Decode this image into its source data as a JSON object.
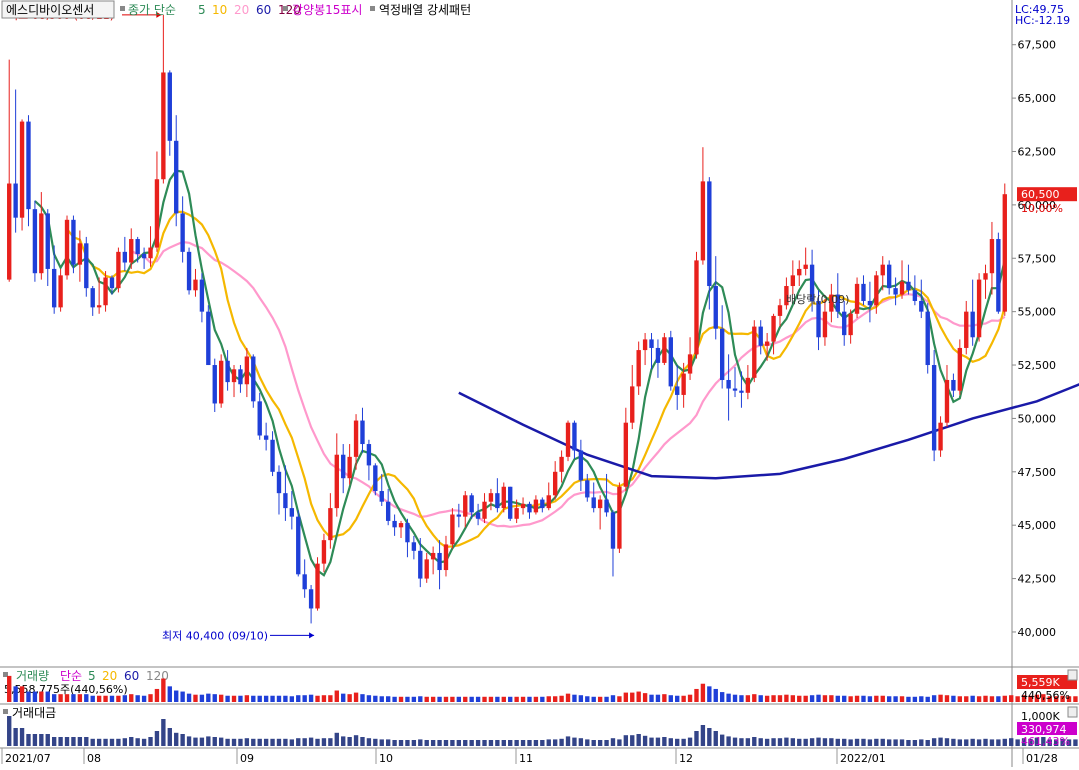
{
  "header": {
    "stock_name": "에스디바이오센서",
    "price_label": "종가",
    "ma_label": "단순",
    "ma_periods": [
      "5",
      "10",
      "20",
      "60",
      "120"
    ],
    "ma_colors": [
      "#2e8b57",
      "#f5b800",
      "#ff99cc",
      "#1a1aa8",
      "#800040"
    ],
    "highlight_label": "강양봉15표시",
    "pattern_label": "역정배열 강세패턴",
    "lc_label": "LC:49.75",
    "hc_label": "HC:-12.19"
  },
  "annotations": {
    "high": "최고 68,900 (08/11)",
    "low": "최저 40,400 (09/10)",
    "dividend": "배당락(0.09)"
  },
  "price_axis": {
    "ticks": [
      "67,500",
      "65,000",
      "62,500",
      "60,000",
      "57,500",
      "55,000",
      "52,500",
      "50,000",
      "47,500",
      "45,000",
      "42,500",
      "40,000"
    ],
    "current_price": "60,500",
    "current_pct": "10,00%"
  },
  "date_axis": [
    "2021/07",
    "08",
    "09",
    "10",
    "11",
    "12",
    "2022/01",
    "01/28"
  ],
  "volume_panel": {
    "title": "거래량",
    "ma_label": "단순",
    "ma_periods": [
      "5",
      "20",
      "60",
      "120"
    ],
    "value_text": "5,558,775주(440,56%)",
    "badge": "5,559K",
    "badge_pct": "440,56%"
  },
  "amount_panel": {
    "title": "거래대금",
    "axis_label": "1,000K",
    "badge": "330,974",
    "badge_pct": "461,43%"
  },
  "colors": {
    "up": "#e8201c",
    "down": "#1f3fd8",
    "highlight": "#c8f8fa",
    "badge": "#e8201c"
  },
  "chart_data": {
    "type": "candlestick",
    "y_unit": "KRW",
    "ylim": [
      38500,
      69500
    ],
    "candles": [
      {
        "o": 56500,
        "h": 66800,
        "l": 56400,
        "c": 61000
      },
      {
        "o": 61000,
        "h": 65400,
        "l": 58700,
        "c": 59400
      },
      {
        "o": 59400,
        "h": 64000,
        "l": 58800,
        "c": 63900
      },
      {
        "o": 63900,
        "h": 64200,
        "l": 59000,
        "c": 59800
      },
      {
        "o": 59800,
        "h": 60200,
        "l": 56400,
        "c": 56800
      },
      {
        "o": 56800,
        "h": 60600,
        "l": 56500,
        "c": 59600
      },
      {
        "o": 59600,
        "h": 59800,
        "l": 56200,
        "c": 57000
      },
      {
        "o": 57000,
        "h": 58100,
        "l": 54900,
        "c": 55200
      },
      {
        "o": 55200,
        "h": 57000,
        "l": 55000,
        "c": 56700
      },
      {
        "o": 56700,
        "h": 59500,
        "l": 56500,
        "c": 59300
      },
      {
        "o": 59300,
        "h": 59500,
        "l": 56800,
        "c": 57200
      },
      {
        "o": 57200,
        "h": 58800,
        "l": 56400,
        "c": 58200
      },
      {
        "o": 58200,
        "h": 58500,
        "l": 55700,
        "c": 56100
      },
      {
        "o": 56100,
        "h": 56200,
        "l": 54800,
        "c": 55200
      },
      {
        "o": 55200,
        "h": 56600,
        "l": 54900,
        "c": 55300
      },
      {
        "o": 55300,
        "h": 56900,
        "l": 55000,
        "c": 56600
      },
      {
        "o": 56600,
        "h": 56700,
        "l": 55800,
        "c": 56100
      },
      {
        "o": 56100,
        "h": 58000,
        "l": 55900,
        "c": 57800
      },
      {
        "o": 57800,
        "h": 58500,
        "l": 56900,
        "c": 57300
      },
      {
        "o": 57300,
        "h": 58900,
        "l": 57000,
        "c": 58400
      },
      {
        "o": 58400,
        "h": 58500,
        "l": 57300,
        "c": 57700
      },
      {
        "o": 57700,
        "h": 58000,
        "l": 57000,
        "c": 57500
      },
      {
        "o": 57500,
        "h": 59000,
        "l": 57100,
        "c": 58000
      },
      {
        "o": 58000,
        "h": 62500,
        "l": 57800,
        "c": 61200
      },
      {
        "o": 61200,
        "h": 68900,
        "l": 61000,
        "c": 66200
      },
      {
        "o": 66200,
        "h": 66300,
        "l": 62300,
        "c": 63000
      },
      {
        "o": 63000,
        "h": 64200,
        "l": 59000,
        "c": 59600
      },
      {
        "o": 59600,
        "h": 60400,
        "l": 57300,
        "c": 57800
      },
      {
        "o": 57800,
        "h": 58000,
        "l": 55800,
        "c": 56000
      },
      {
        "o": 56000,
        "h": 57000,
        "l": 55700,
        "c": 56500
      },
      {
        "o": 56500,
        "h": 56800,
        "l": 54500,
        "c": 55000
      },
      {
        "o": 55000,
        "h": 55300,
        "l": 52500,
        "c": 52500
      },
      {
        "o": 52500,
        "h": 52800,
        "l": 50300,
        "c": 50700
      },
      {
        "o": 50700,
        "h": 53000,
        "l": 50500,
        "c": 52700
      },
      {
        "o": 52700,
        "h": 53200,
        "l": 51300,
        "c": 51700
      },
      {
        "o": 51700,
        "h": 52500,
        "l": 51000,
        "c": 52300
      },
      {
        "o": 52300,
        "h": 52500,
        "l": 51200,
        "c": 51600
      },
      {
        "o": 51600,
        "h": 53300,
        "l": 51000,
        "c": 52900
      },
      {
        "o": 52900,
        "h": 53000,
        "l": 50500,
        "c": 50800
      },
      {
        "o": 50800,
        "h": 51200,
        "l": 49000,
        "c": 49200
      },
      {
        "o": 49200,
        "h": 49800,
        "l": 48500,
        "c": 49000
      },
      {
        "o": 49000,
        "h": 49400,
        "l": 47300,
        "c": 47500
      },
      {
        "o": 47500,
        "h": 47800,
        "l": 45500,
        "c": 46500
      },
      {
        "o": 46500,
        "h": 47800,
        "l": 45200,
        "c": 45800
      },
      {
        "o": 45800,
        "h": 46600,
        "l": 44800,
        "c": 45400
      },
      {
        "o": 45400,
        "h": 45700,
        "l": 42600,
        "c": 42700
      },
      {
        "o": 42700,
        "h": 43400,
        "l": 41600,
        "c": 42000
      },
      {
        "o": 42000,
        "h": 42200,
        "l": 40400,
        "c": 41100
      },
      {
        "o": 41100,
        "h": 43500,
        "l": 41000,
        "c": 43200
      },
      {
        "o": 43200,
        "h": 44600,
        "l": 42800,
        "c": 44300
      },
      {
        "o": 44300,
        "h": 46500,
        "l": 43900,
        "c": 45800
      },
      {
        "o": 45800,
        "h": 49300,
        "l": 45400,
        "c": 48300
      },
      {
        "o": 48300,
        "h": 48800,
        "l": 46500,
        "c": 47200
      },
      {
        "o": 47200,
        "h": 48800,
        "l": 46900,
        "c": 48200
      },
      {
        "o": 48200,
        "h": 50200,
        "l": 47600,
        "c": 49900
      },
      {
        "o": 49900,
        "h": 50500,
        "l": 48400,
        "c": 48800
      },
      {
        "o": 48800,
        "h": 49000,
        "l": 47100,
        "c": 47800
      },
      {
        "o": 47800,
        "h": 47900,
        "l": 46400,
        "c": 46600
      },
      {
        "o": 46600,
        "h": 47400,
        "l": 45900,
        "c": 46100
      },
      {
        "o": 46100,
        "h": 46700,
        "l": 45000,
        "c": 45200
      },
      {
        "o": 45200,
        "h": 45500,
        "l": 44500,
        "c": 44900
      },
      {
        "o": 44900,
        "h": 45200,
        "l": 44400,
        "c": 45100
      },
      {
        "o": 45100,
        "h": 45300,
        "l": 43500,
        "c": 44200
      },
      {
        "o": 44200,
        "h": 44500,
        "l": 43400,
        "c": 43800
      },
      {
        "o": 43800,
        "h": 44400,
        "l": 42100,
        "c": 42500
      },
      {
        "o": 42500,
        "h": 43700,
        "l": 42300,
        "c": 43400
      },
      {
        "o": 43400,
        "h": 44000,
        "l": 42700,
        "c": 43700
      },
      {
        "o": 43700,
        "h": 44300,
        "l": 42000,
        "c": 42900
      },
      {
        "o": 42900,
        "h": 44500,
        "l": 42600,
        "c": 44100
      },
      {
        "o": 44100,
        "h": 45800,
        "l": 43900,
        "c": 45500
      },
      {
        "o": 45500,
        "h": 46000,
        "l": 44900,
        "c": 45400
      },
      {
        "o": 45400,
        "h": 46600,
        "l": 44900,
        "c": 46400
      },
      {
        "o": 46400,
        "h": 46500,
        "l": 45300,
        "c": 45600
      },
      {
        "o": 45600,
        "h": 46000,
        "l": 45000,
        "c": 45300
      },
      {
        "o": 45300,
        "h": 46500,
        "l": 45100,
        "c": 46100
      },
      {
        "o": 46100,
        "h": 46700,
        "l": 45700,
        "c": 46500
      },
      {
        "o": 46500,
        "h": 47200,
        "l": 45600,
        "c": 45800
      },
      {
        "o": 45800,
        "h": 47000,
        "l": 45600,
        "c": 46800
      },
      {
        "o": 46800,
        "h": 46800,
        "l": 45200,
        "c": 45300
      },
      {
        "o": 45300,
        "h": 46200,
        "l": 45100,
        "c": 45800
      },
      {
        "o": 45800,
        "h": 46300,
        "l": 45500,
        "c": 46000
      },
      {
        "o": 46000,
        "h": 46100,
        "l": 45300,
        "c": 45600
      },
      {
        "o": 45600,
        "h": 46400,
        "l": 45500,
        "c": 46200
      },
      {
        "o": 46200,
        "h": 46300,
        "l": 45600,
        "c": 45800
      },
      {
        "o": 45800,
        "h": 47000,
        "l": 45700,
        "c": 46400
      },
      {
        "o": 46400,
        "h": 48000,
        "l": 46200,
        "c": 47500
      },
      {
        "o": 47500,
        "h": 48500,
        "l": 47000,
        "c": 48200
      },
      {
        "o": 48200,
        "h": 49900,
        "l": 48000,
        "c": 49800
      },
      {
        "o": 49800,
        "h": 49900,
        "l": 48100,
        "c": 48500
      },
      {
        "o": 48500,
        "h": 49000,
        "l": 46600,
        "c": 47100
      },
      {
        "o": 47100,
        "h": 47400,
        "l": 46100,
        "c": 46300
      },
      {
        "o": 46300,
        "h": 47000,
        "l": 45600,
        "c": 45800
      },
      {
        "o": 45800,
        "h": 46400,
        "l": 44800,
        "c": 46200
      },
      {
        "o": 46200,
        "h": 47400,
        "l": 45400,
        "c": 45600
      },
      {
        "o": 45600,
        "h": 45700,
        "l": 42600,
        "c": 43900
      },
      {
        "o": 43900,
        "h": 47000,
        "l": 43700,
        "c": 46800
      },
      {
        "o": 46800,
        "h": 50500,
        "l": 46600,
        "c": 49800
      },
      {
        "o": 49800,
        "h": 52500,
        "l": 49500,
        "c": 51500
      },
      {
        "o": 51500,
        "h": 53600,
        "l": 51100,
        "c": 53200
      },
      {
        "o": 53200,
        "h": 54000,
        "l": 52500,
        "c": 53700
      },
      {
        "o": 53700,
        "h": 54000,
        "l": 52300,
        "c": 53300
      },
      {
        "o": 53300,
        "h": 53700,
        "l": 51900,
        "c": 52600
      },
      {
        "o": 52600,
        "h": 54000,
        "l": 52500,
        "c": 53800
      },
      {
        "o": 53800,
        "h": 54100,
        "l": 51300,
        "c": 51500
      },
      {
        "o": 51500,
        "h": 52500,
        "l": 50400,
        "c": 51100
      },
      {
        "o": 51100,
        "h": 52600,
        "l": 50500,
        "c": 52100
      },
      {
        "o": 52100,
        "h": 53800,
        "l": 51800,
        "c": 53000
      },
      {
        "o": 53000,
        "h": 57800,
        "l": 52800,
        "c": 57400
      },
      {
        "o": 57400,
        "h": 62700,
        "l": 57200,
        "c": 61100
      },
      {
        "o": 61100,
        "h": 61300,
        "l": 55100,
        "c": 56200
      },
      {
        "o": 56200,
        "h": 57600,
        "l": 53700,
        "c": 54200
      },
      {
        "o": 54200,
        "h": 55300,
        "l": 51400,
        "c": 51800
      },
      {
        "o": 51800,
        "h": 53000,
        "l": 49900,
        "c": 51400
      },
      {
        "o": 51400,
        "h": 52400,
        "l": 51000,
        "c": 51300
      },
      {
        "o": 51300,
        "h": 52200,
        "l": 50500,
        "c": 51200
      },
      {
        "o": 51200,
        "h": 52500,
        "l": 50900,
        "c": 51900
      },
      {
        "o": 51900,
        "h": 54600,
        "l": 51700,
        "c": 54300
      },
      {
        "o": 54300,
        "h": 54600,
        "l": 53000,
        "c": 53400
      },
      {
        "o": 53400,
        "h": 54000,
        "l": 52700,
        "c": 53600
      },
      {
        "o": 53600,
        "h": 54900,
        "l": 53000,
        "c": 54800
      },
      {
        "o": 54800,
        "h": 55600,
        "l": 54300,
        "c": 55300
      },
      {
        "o": 55300,
        "h": 56600,
        "l": 55100,
        "c": 56200
      },
      {
        "o": 56200,
        "h": 57400,
        "l": 55800,
        "c": 56700
      },
      {
        "o": 56700,
        "h": 57400,
        "l": 56200,
        "c": 57000
      },
      {
        "o": 57000,
        "h": 58000,
        "l": 56700,
        "c": 57200
      },
      {
        "o": 57200,
        "h": 57900,
        "l": 55000,
        "c": 55500
      },
      {
        "o": 55500,
        "h": 56000,
        "l": 53200,
        "c": 53800
      },
      {
        "o": 53800,
        "h": 55600,
        "l": 53400,
        "c": 55000
      },
      {
        "o": 55000,
        "h": 56300,
        "l": 54500,
        "c": 55800
      },
      {
        "o": 55800,
        "h": 56800,
        "l": 54700,
        "c": 55000
      },
      {
        "o": 55000,
        "h": 55500,
        "l": 53400,
        "c": 53900
      },
      {
        "o": 53900,
        "h": 55100,
        "l": 53500,
        "c": 54900
      },
      {
        "o": 54900,
        "h": 56600,
        "l": 54700,
        "c": 56300
      },
      {
        "o": 56300,
        "h": 56700,
        "l": 55300,
        "c": 55500
      },
      {
        "o": 55500,
        "h": 56400,
        "l": 54500,
        "c": 55300
      },
      {
        "o": 55300,
        "h": 56900,
        "l": 54900,
        "c": 56700
      },
      {
        "o": 56700,
        "h": 57600,
        "l": 56000,
        "c": 57200
      },
      {
        "o": 57200,
        "h": 57400,
        "l": 55800,
        "c": 56100
      },
      {
        "o": 56100,
        "h": 56600,
        "l": 55300,
        "c": 55800
      },
      {
        "o": 55800,
        "h": 57400,
        "l": 55600,
        "c": 56400
      },
      {
        "o": 56400,
        "h": 57200,
        "l": 55800,
        "c": 56000
      },
      {
        "o": 56000,
        "h": 56700,
        "l": 55300,
        "c": 55500
      },
      {
        "o": 55500,
        "h": 56500,
        "l": 54700,
        "c": 55000
      },
      {
        "o": 55000,
        "h": 55400,
        "l": 52100,
        "c": 52500
      },
      {
        "o": 52500,
        "h": 53200,
        "l": 48000,
        "c": 48500
      },
      {
        "o": 48500,
        "h": 50100,
        "l": 48200,
        "c": 49800
      },
      {
        "o": 49800,
        "h": 52500,
        "l": 49600,
        "c": 51800
      },
      {
        "o": 51800,
        "h": 52100,
        "l": 51000,
        "c": 51300
      },
      {
        "o": 51300,
        "h": 53700,
        "l": 51100,
        "c": 53300
      },
      {
        "o": 53300,
        "h": 55500,
        "l": 53000,
        "c": 55000
      },
      {
        "o": 55000,
        "h": 56500,
        "l": 53400,
        "c": 53800
      },
      {
        "o": 53800,
        "h": 56800,
        "l": 53600,
        "c": 56500
      },
      {
        "o": 56500,
        "h": 57200,
        "l": 55600,
        "c": 56800
      },
      {
        "o": 56800,
        "h": 59200,
        "l": 55800,
        "c": 58400
      },
      {
        "o": 58400,
        "h": 58700,
        "l": 54900,
        "c": 55000
      },
      {
        "o": 55000,
        "h": 61000,
        "l": 54800,
        "c": 60500
      }
    ],
    "ma60_series": [
      {
        "i": 70,
        "v": 51200
      },
      {
        "i": 80,
        "v": 49700
      },
      {
        "i": 90,
        "v": 48300
      },
      {
        "i": 100,
        "v": 47300
      },
      {
        "i": 110,
        "v": 47200
      },
      {
        "i": 120,
        "v": 47400
      },
      {
        "i": 130,
        "v": 48100
      },
      {
        "i": 140,
        "v": 49000
      },
      {
        "i": 150,
        "v": 50000
      },
      {
        "i": 160,
        "v": 50800
      },
      {
        "i": 165,
        "v": 51400
      },
      {
        "i": 170,
        "v": 52000
      },
      {
        "i": 175,
        "v": 52300
      },
      {
        "i": 180,
        "v": 52700
      },
      {
        "i": 186,
        "v": 53500
      }
    ],
    "ma120_series": [
      {
        "i": 172,
        "v": 51600
      },
      {
        "i": 178,
        "v": 51400
      },
      {
        "i": 183,
        "v": 51200
      },
      {
        "i": 186,
        "v": 51100
      }
    ],
    "volume": [
      5,
      3,
      3,
      2,
      2,
      2,
      2,
      1.5,
      1.5,
      1.5,
      1.5,
      1.5,
      1.5,
      1.2,
      1.2,
      1.2,
      1.2,
      1.2,
      1.3,
      1.5,
      1.3,
      1.2,
      1.5,
      2.5,
      4.5,
      3,
      2.2,
      2,
      1.6,
      1.4,
      1.4,
      1.6,
      1.5,
      1.4,
      1.2,
      1.2,
      1.2,
      1.3,
      1.2,
      1.2,
      1.2,
      1.2,
      1.2,
      1.2,
      1.1,
      1.3,
      1.3,
      1.4,
      1.2,
      1.3,
      1.3,
      2.2,
      1.6,
      1.5,
      1.8,
      1.5,
      1.3,
      1.2,
      1.1,
      1.1,
      1.0,
      1.0,
      1.0,
      1.0,
      1.1,
      1.0,
      1.0,
      1.0,
      1.0,
      1.0,
      1.0,
      1.0,
      1.0,
      1.0,
      1.0,
      1.0,
      1.0,
      1.0,
      1.0,
      1.0,
      1.0,
      1.0,
      1.0,
      1.0,
      1.1,
      1.1,
      1.2,
      1.6,
      1.4,
      1.3,
      1.1,
      1.0,
      1.0,
      1.0,
      1.3,
      1.1,
      1.8,
      1.8,
      2.0,
      1.7,
      1.4,
      1.4,
      1.5,
      1.3,
      1.2,
      1.2,
      1.4,
      2.5,
      3.5,
      3.0,
      2.5,
      1.9,
      1.6,
      1.4,
      1.3,
      1.3,
      1.5,
      1.3,
      1.2,
      1.3,
      1.3,
      1.4,
      1.3,
      1.2,
      1.2,
      1.3,
      1.4,
      1.3,
      1.3,
      1.2,
      1.2,
      1.1,
      1.2,
      1.2,
      1.1,
      1.2,
      1.2,
      1.1,
      1.1,
      1.1,
      1.0,
      1.0,
      1.1,
      1.0,
      1.3,
      1.4,
      1.3,
      1.2,
      1.1,
      1.1,
      1.2,
      1.1,
      1.2,
      1.1,
      1.1,
      1.2,
      1.3,
      1.1,
      1.3,
      1.2,
      1.4,
      1.5,
      1.1,
      1.1,
      1.2,
      1.1,
      1.1,
      1.1,
      1.2,
      1.3,
      1.2,
      1.2,
      1.1,
      1.1,
      1.1,
      1.2,
      1.1,
      1.1,
      1.2,
      1.3,
      1.4,
      1.3,
      1.2,
      1.3,
      1.5,
      1.5,
      1.4,
      1.3,
      1.6,
      1.4,
      3.2
    ]
  }
}
